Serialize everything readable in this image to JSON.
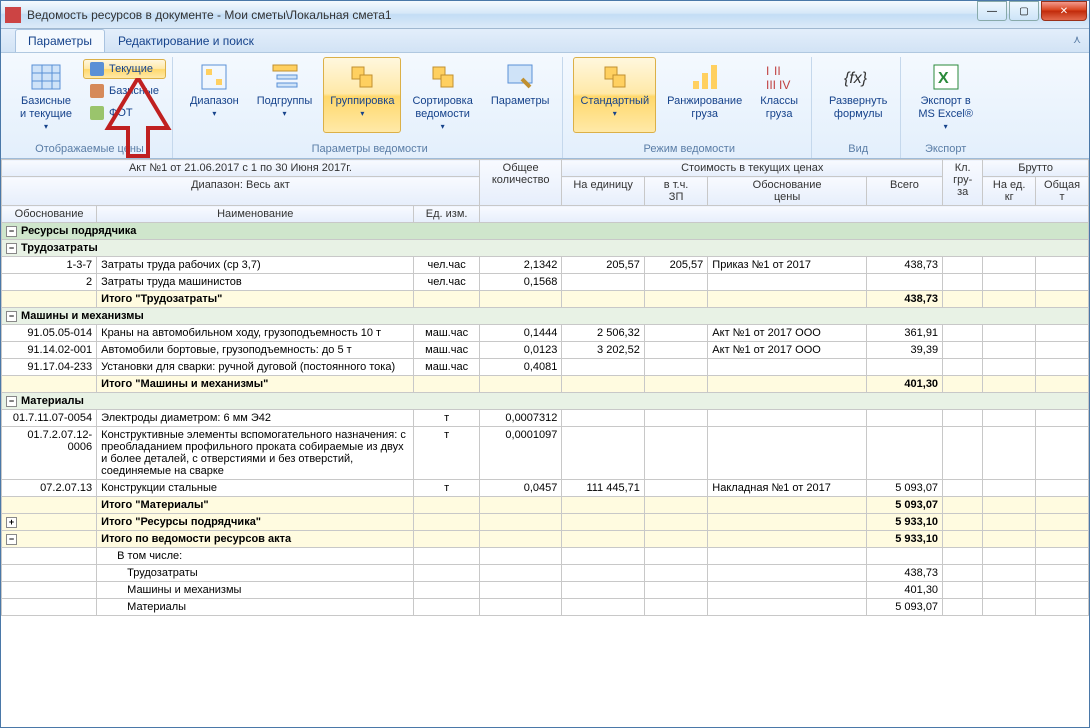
{
  "window": {
    "title": "Ведомость ресурсов в документе - Мои сметы\\Локальная смета1"
  },
  "tabs": {
    "params": "Параметры",
    "edit": "Редактирование и поиск"
  },
  "ribbon": {
    "group1": {
      "label": "Отображаемые цены",
      "btn_base": "Базисные\nи текущие",
      "opt_cur": "Текущие",
      "opt_base": "Базисные",
      "opt_fot": "ФОТ"
    },
    "group2": {
      "label": "Параметры ведомости",
      "range": "Диапазон",
      "subgroups": "Подгруппы",
      "grouping": "Группировка",
      "sorting": "Сортировка\nведомости",
      "params": "Параметры"
    },
    "group3": {
      "label": "Режим ведомости",
      "standard": "Стандартный",
      "ranking": "Ранжирование\nгруза",
      "classes": "Классы\nгруза"
    },
    "group4": {
      "label": "Вид",
      "expand": "Развернуть\nформулы"
    },
    "group5": {
      "label": "Экспорт",
      "export": "Экспорт в\nMS Excel®"
    }
  },
  "header_info": {
    "act": "Акт №1 от 21.06.2017 с 1 по 30 Июня 2017г.",
    "range": "Диапазон: Весь акт"
  },
  "columns": {
    "code": "Обоснование",
    "name": "Наименование",
    "unit": "Ед. изм.",
    "qty": "Общее\nколичество",
    "prices_group": "Стоимость в текущих ценах",
    "unit_price": "На единицу",
    "zp": "в т.ч.\nЗП",
    "basis": "Обоснование\nцены",
    "total": "Всего",
    "kl": "Кл.\nгру-\nза",
    "brutto": "Брутто",
    "bed": "На ед.\nкг",
    "btot": "Общая\nт"
  },
  "sections": {
    "contractor": "Ресурсы подрядчика",
    "labor": "Трудозатраты",
    "labor_total": "Итого \"Трудозатраты\"",
    "machines": "Машины и механизмы",
    "machines_total": "Итого \"Машины и механизмы\"",
    "materials": "Материалы",
    "materials_total": "Итого \"Материалы\"",
    "contractor_total": "Итого \"Ресурсы подрядчика\"",
    "act_total": "Итого по ведомости ресурсов акта",
    "including": "В том числе:",
    "inc_labor": "Трудозатраты",
    "inc_machines": "Машины и механизмы",
    "inc_materials": "Материалы"
  },
  "rows": {
    "r1": {
      "code": "1-3-7",
      "name": "Затраты труда рабочих (ср 3,7)",
      "unit": "чел.час",
      "qty": "2,1342",
      "price": "205,57",
      "zp": "205,57",
      "basis": "Приказ №1 от 2017",
      "total": "438,73"
    },
    "r2": {
      "code": "2",
      "name": "Затраты труда машинистов",
      "unit": "чел.час",
      "qty": "0,1568"
    },
    "r3": {
      "code": "91.05.05-014",
      "name": "Краны на автомобильном ходу, грузоподъемность 10 т",
      "unit": "маш.час",
      "qty": "0,1444",
      "price": "2 506,32",
      "basis": "Акт №1 от 2017 ООО",
      "total": "361,91"
    },
    "r4": {
      "code": "91.14.02-001",
      "name": "Автомобили бортовые, грузоподъемность: до 5 т",
      "unit": "маш.час",
      "qty": "0,0123",
      "price": "3 202,52",
      "basis": "Акт №1 от 2017 ООО",
      "total": "39,39"
    },
    "r5": {
      "code": "91.17.04-233",
      "name": "Установки для сварки: ручной дуговой (постоянного тока)",
      "unit": "маш.час",
      "qty": "0,4081"
    },
    "r6": {
      "code": "01.7.11.07-0054",
      "name": "Электроды диаметром: 6 мм Э42",
      "unit": "т",
      "qty": "0,0007312"
    },
    "r7": {
      "code": "01.7.2.07.12-0006",
      "name": "Конструктивные элементы вспомогательного назначения: с преобладанием профильного проката собираемые из двух и более деталей, с отверстиями и без отверстий, соединяемые на сварке",
      "unit": "т",
      "qty": "0,0001097"
    },
    "r8": {
      "code": "07.2.07.13",
      "name": "Конструкции стальные",
      "unit": "т",
      "qty": "0,0457",
      "price": "111 445,71",
      "basis": "Накладная №1 от 2017",
      "total": "5 093,07"
    }
  },
  "totals": {
    "labor": "438,73",
    "machines": "401,30",
    "materials": "5 093,07",
    "contractor": "5 933,10",
    "act": "5 933,10",
    "inc_labor": "438,73",
    "inc_machines": "401,30",
    "inc_materials": "5 093,07"
  }
}
